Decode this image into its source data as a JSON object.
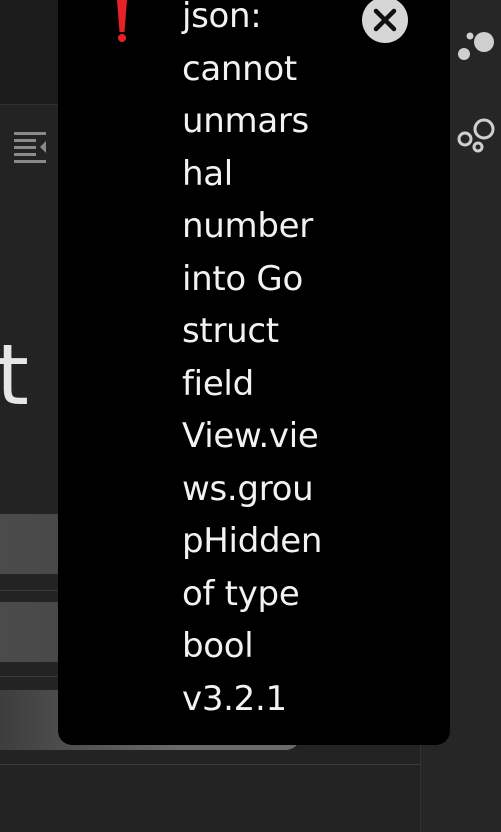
{
  "background_letter": "t",
  "toast": {
    "message_lines": [
      "json:",
      "cannot",
      "unmars",
      "hal",
      "number",
      "into Go",
      "struct",
      "field",
      "View.vie",
      "ws.grou",
      "pHidden",
      "of type",
      "bool",
      "v3.2.1"
    ],
    "icon": "exclamation-icon",
    "close_icon": "close-icon",
    "accent_color": "#e8202a"
  },
  "sidebar_icons": [
    "dots-cluster-icon",
    "circles-cluster-icon"
  ],
  "toolbar_icons": [
    "outline-toggle-icon"
  ]
}
